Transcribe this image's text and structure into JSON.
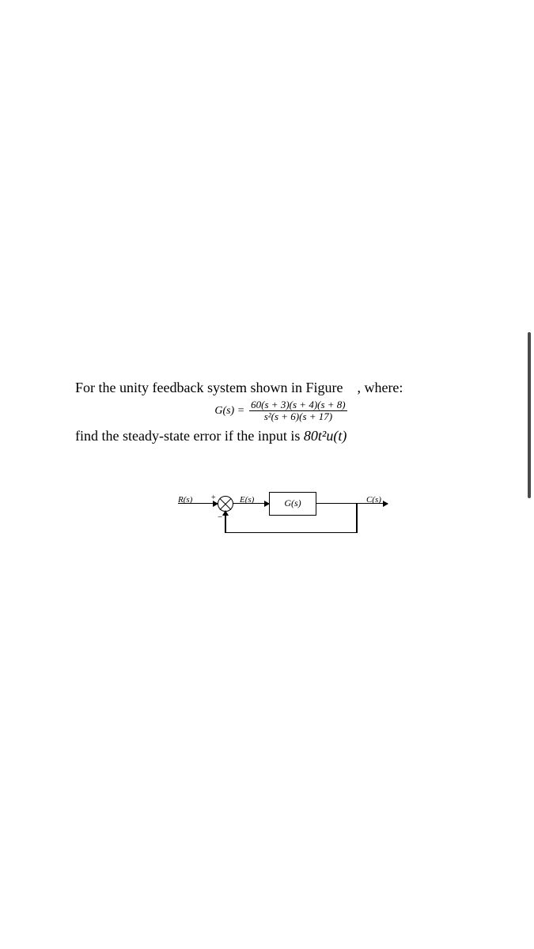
{
  "problem": {
    "line1_prefix": "For the unity feedback system shown in Figure",
    "line1_suffix": ", where:",
    "equation": {
      "lhs": "G(s) =",
      "numerator": "60(s + 3)(s + 4)(s + 8)",
      "denominator": "s²(s + 6)(s + 17)"
    },
    "line3_prefix": "find the steady-state error if the input is ",
    "line3_input": "80t²u(t)"
  },
  "diagram": {
    "input_label": "R(s)",
    "error_label": "E(s)",
    "block_label": "G(s)",
    "output_label": "C(s)",
    "sum_plus": "+",
    "sum_minus": "−"
  }
}
